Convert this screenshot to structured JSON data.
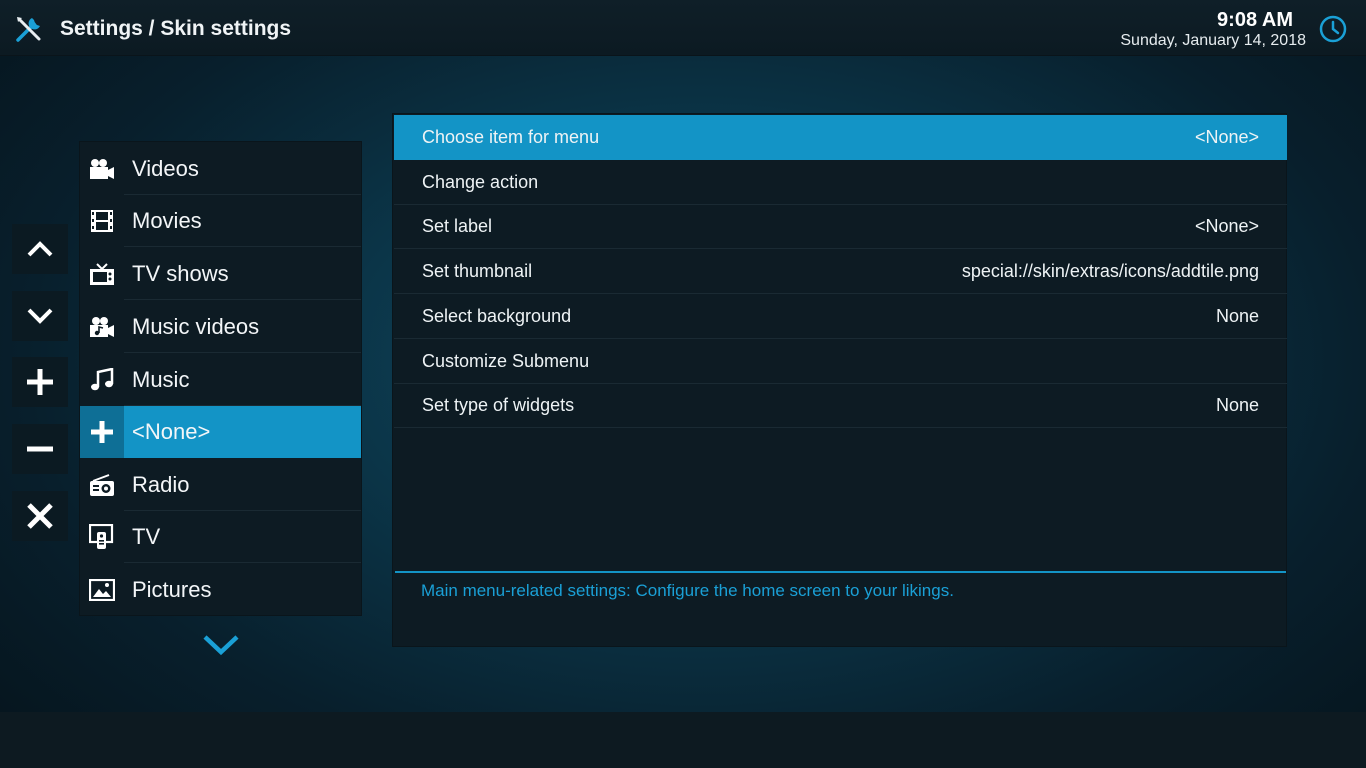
{
  "header": {
    "title": "Settings / Skin settings",
    "time": "9:08 AM",
    "date": "Sunday, January 14, 2018"
  },
  "controls": [
    {
      "name": "move-up-button",
      "icon": "chevron-up-icon"
    },
    {
      "name": "move-down-button",
      "icon": "chevron-down-icon"
    },
    {
      "name": "add-button",
      "icon": "plus-icon"
    },
    {
      "name": "remove-button",
      "icon": "minus-icon"
    },
    {
      "name": "reset-button",
      "icon": "close-icon"
    }
  ],
  "menu": {
    "items": [
      {
        "label": "Videos",
        "icon": "video-camera-icon"
      },
      {
        "label": "Movies",
        "icon": "film-strip-icon"
      },
      {
        "label": "TV shows",
        "icon": "tv-icon"
      },
      {
        "label": "Music videos",
        "icon": "music-video-icon"
      },
      {
        "label": "Music",
        "icon": "music-note-icon"
      },
      {
        "label": "<None>",
        "icon": "plus-icon",
        "selected": true
      },
      {
        "label": "Radio",
        "icon": "radio-icon"
      },
      {
        "label": "TV",
        "icon": "live-tv-icon"
      },
      {
        "label": "Pictures",
        "icon": "picture-icon"
      }
    ]
  },
  "settings": {
    "rows": [
      {
        "label": "Choose item for menu",
        "value": "<None>",
        "selected": true
      },
      {
        "label": "Change action",
        "value": ""
      },
      {
        "label": "Set label",
        "value": "<None>"
      },
      {
        "label": "Set thumbnail",
        "value": "special://skin/extras/icons/addtile.png"
      },
      {
        "label": "Select background",
        "value": "None"
      },
      {
        "label": "Customize Submenu",
        "value": ""
      },
      {
        "label": "Set type of widgets",
        "value": "None"
      }
    ],
    "description": "Main menu-related settings: Configure the home screen to your likings."
  },
  "colors": {
    "accent": "#1394c6",
    "accent_dark": "#0e6f96",
    "panel": "#0d1b23",
    "description_text": "#1aa0d6"
  }
}
